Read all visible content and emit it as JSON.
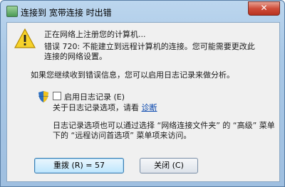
{
  "window": {
    "title": "连接到 宽带连接 时出错",
    "close_glyph": "✕"
  },
  "icons": {
    "title_icon": "network-icon",
    "main_icon": "warning-icon",
    "checkbox_icon": "uac-shield-icon"
  },
  "content": {
    "line_registering": "正在网络上注册您的计算机...",
    "error_line1": "错误 720: 不能建立到远程计算机的连接。您可能需要更改此",
    "error_line2": "连接的网络设置。",
    "report_info": "如果您继续收到错误信息，您可以启用日志记录来做分析。",
    "logging_checkbox_label": "启用日志记录 (E)",
    "logging_about_prefix": "关于日志记录选项，请看",
    "logging_about_link": "诊断",
    "note_line1": "日志记录选项也可以通过选择 “网络连接文件夹” 的 “高级” 菜单",
    "note_line2": "下的 “远程访问首选项” 菜单项来访问。"
  },
  "buttons": {
    "redial": "重拨 (R) = 57",
    "close": "关闭 (C)"
  },
  "colors": {
    "title_bar": "#a9c8e6",
    "client_bg": "#f0f0f0",
    "close_btn": "#cf4d3a",
    "link": "#0645ad"
  }
}
